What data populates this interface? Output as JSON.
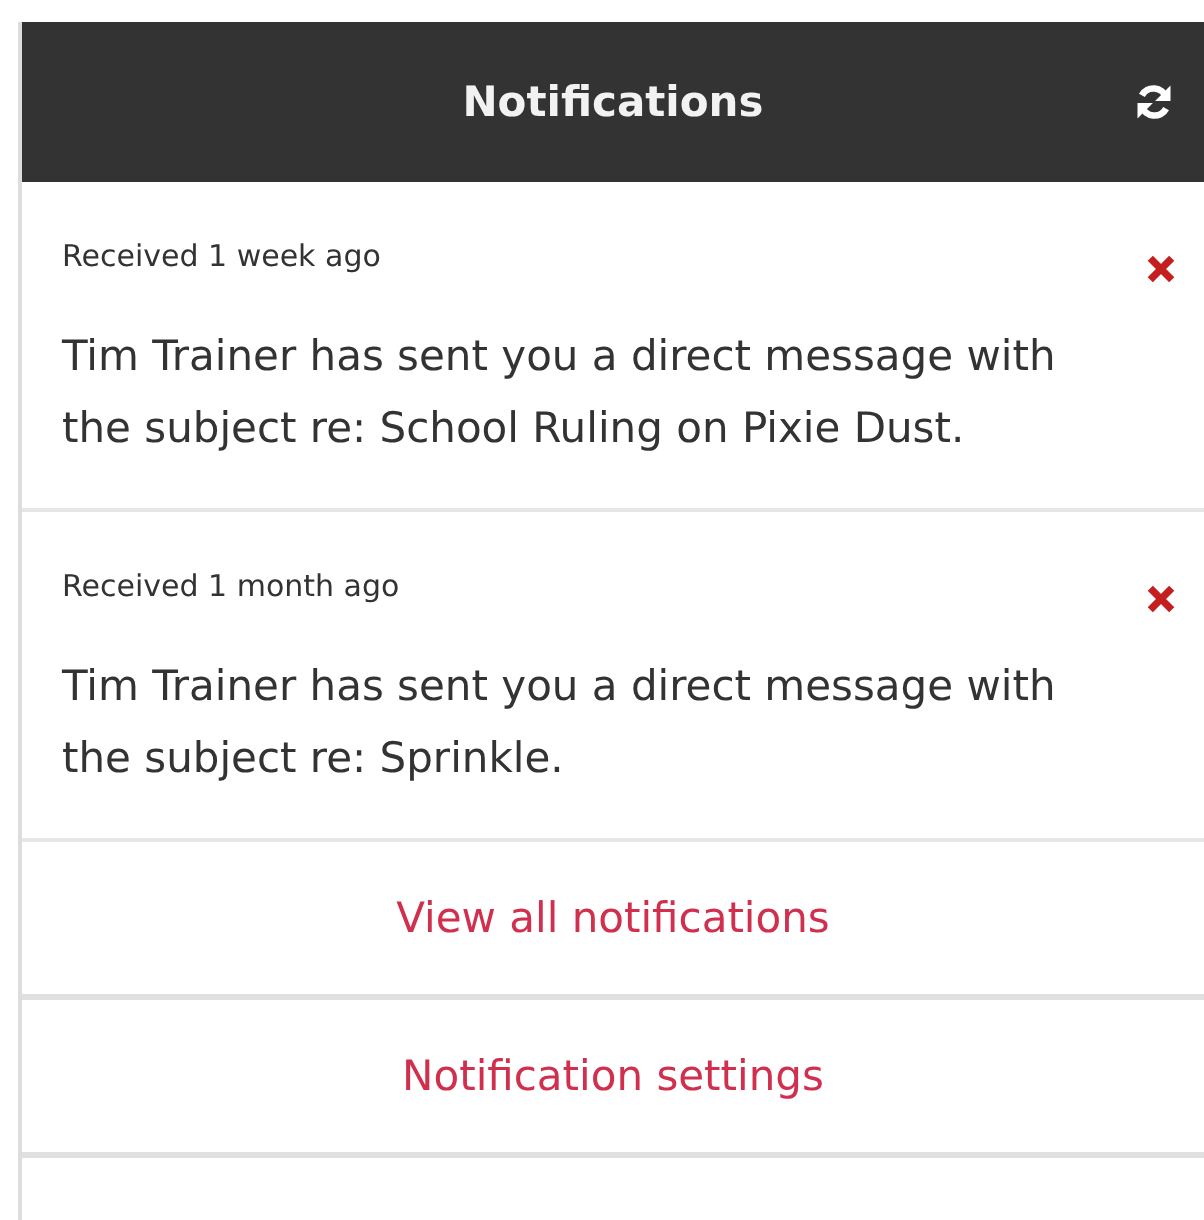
{
  "header": {
    "title": "Notifications"
  },
  "notifications": [
    {
      "received": "Received 1 week ago",
      "message": "Tim Trainer has sent you a direct message with the subject re: School Ruling on Pixie Dust."
    },
    {
      "received": "Received 1 month ago",
      "message": "Tim Trainer has sent you a direct message with the subject re: Sprinkle."
    }
  ],
  "links": [
    "View all notifications",
    "Notification settings"
  ]
}
